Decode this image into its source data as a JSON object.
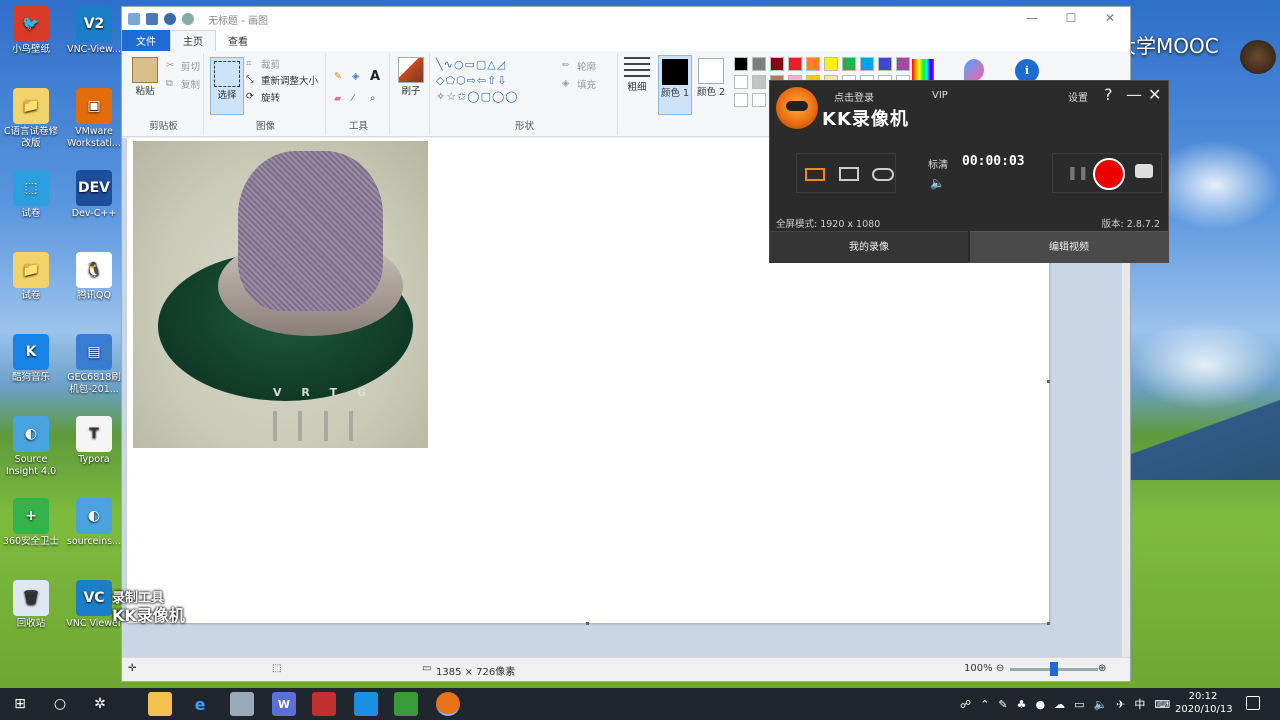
{
  "desktop": {
    "icons": [
      {
        "label": "小鸟壁纸",
        "color": "#d83b2a",
        "glyph": "🐦"
      },
      {
        "label": "VNC-View...",
        "color": "#1a7fc8",
        "glyph": "V2"
      },
      {
        "label": "C语言试卷修改版",
        "color": "#f2d26b",
        "glyph": "📁"
      },
      {
        "label": "VMware Workstati...",
        "color": "#e36c0a",
        "glyph": "▣"
      },
      {
        "label": "试卷",
        "color": "#2d9ee0",
        "glyph": "⬚"
      },
      {
        "label": "Dev-C++",
        "color": "#1d4e9c",
        "glyph": "DEV"
      },
      {
        "label": "试卷",
        "color": "#f2d26b",
        "glyph": "📁"
      },
      {
        "label": "腾讯QQ",
        "color": "#ffffff",
        "glyph": "🐧"
      },
      {
        "label": "酷狗音乐",
        "color": "#1a84e6",
        "glyph": "K"
      },
      {
        "label": "GEC6818刷机包-201...",
        "color": "#3a7bd5",
        "glyph": "▤"
      },
      {
        "label": "Source Insight 4.0",
        "color": "#4aa3df",
        "glyph": "◐"
      },
      {
        "label": "Typora",
        "color": "#f5f5f5",
        "glyph": "T"
      },
      {
        "label": "360安全卫士",
        "color": "#36b24a",
        "glyph": "+"
      },
      {
        "label": "sourceins...",
        "color": "#4aa3df",
        "glyph": "◐"
      },
      {
        "label": "回收站",
        "color": "#dfe8f0",
        "glyph": "🗑"
      },
      {
        "label": "VNC Viewer",
        "color": "#1a7fc8",
        "glyph": "VC"
      }
    ]
  },
  "paint": {
    "title": "无标题 - 画图",
    "tabs": [
      "文件",
      "主页",
      "查看"
    ],
    "clipboard": {
      "paste": "粘贴",
      "cut": "剪切",
      "copy": "复制",
      "label": "剪贴板"
    },
    "image": {
      "select": "选择",
      "crop": "裁剪",
      "resize": "重新调整大小",
      "rotate": "旋转",
      "label": "图像"
    },
    "tools": {
      "label": "工具"
    },
    "brushes": {
      "label": "刷子"
    },
    "shapes": {
      "label": "形状",
      "outline": "轮廓",
      "fill": "填充"
    },
    "size": {
      "label": "粗细"
    },
    "color1": "颜色 1",
    "color2": "颜色 2",
    "palette": [
      "#000000",
      "#7f7f7f",
      "#880015",
      "#ed1c24",
      "#ff7f27",
      "#fff200",
      "#22b14c",
      "#00a2e8",
      "#3f48cc",
      "#a349a4",
      "#ffffff",
      "#c3c3c3",
      "#b97a57",
      "#ffaec9",
      "#ffc90e",
      "#efe4b0"
    ],
    "photo_label": "V R T G",
    "status": {
      "dimensions": "1385 × 726像素",
      "zoom": "100%",
      "zoom_fraction": 0.5
    }
  },
  "kk": {
    "login": "点击登录",
    "vip": "VIP",
    "name": "KK录像机",
    "settings": "设置",
    "help": "?",
    "minimize": "—",
    "close": "✕",
    "quality": "标清",
    "time": "00:00:03",
    "fullscreen": "全屏模式: 1920 x 1080",
    "version": "版本: 2.8.7.2",
    "tab_recordings": "我的录像",
    "tab_edit": "编辑视频"
  },
  "watermark": {
    "mooc": "中国大学MOOC",
    "rec_line1": "录制工具",
    "rec_line2": "KK录像机"
  },
  "taskbar": {
    "time": "20:12",
    "date": "2020/10/13",
    "ime": "中"
  }
}
